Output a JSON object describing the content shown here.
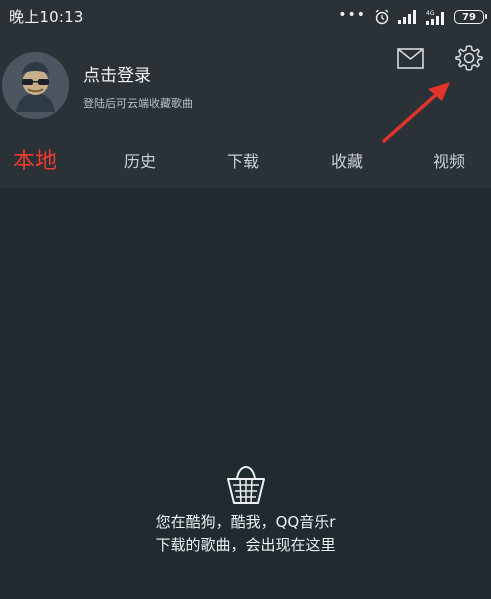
{
  "status_bar": {
    "time": "晚上10:13",
    "dots": "•••",
    "battery": "79"
  },
  "profile": {
    "title": "点击登录",
    "subtitle": "登陆后可云端收藏歌曲"
  },
  "icons": {
    "mail": "mail-icon",
    "settings": "gear-icon",
    "alarm": "alarm-icon",
    "signal": "signal-icon",
    "empty": "basket-icon"
  },
  "tabs": [
    {
      "label": "本地",
      "active": true
    },
    {
      "label": "历史",
      "active": false
    },
    {
      "label": "下载",
      "active": false
    },
    {
      "label": "收藏",
      "active": false
    },
    {
      "label": "视频",
      "active": false
    }
  ],
  "empty_state": {
    "line1": "您在酷狗，酷我，QQ音乐r",
    "line2": "下载的歌曲，会出现在这里"
  },
  "colors": {
    "background": "#1f2a31",
    "header": "#2a3238",
    "accent": "#ef3a2f",
    "text": "#f2f2f2"
  }
}
